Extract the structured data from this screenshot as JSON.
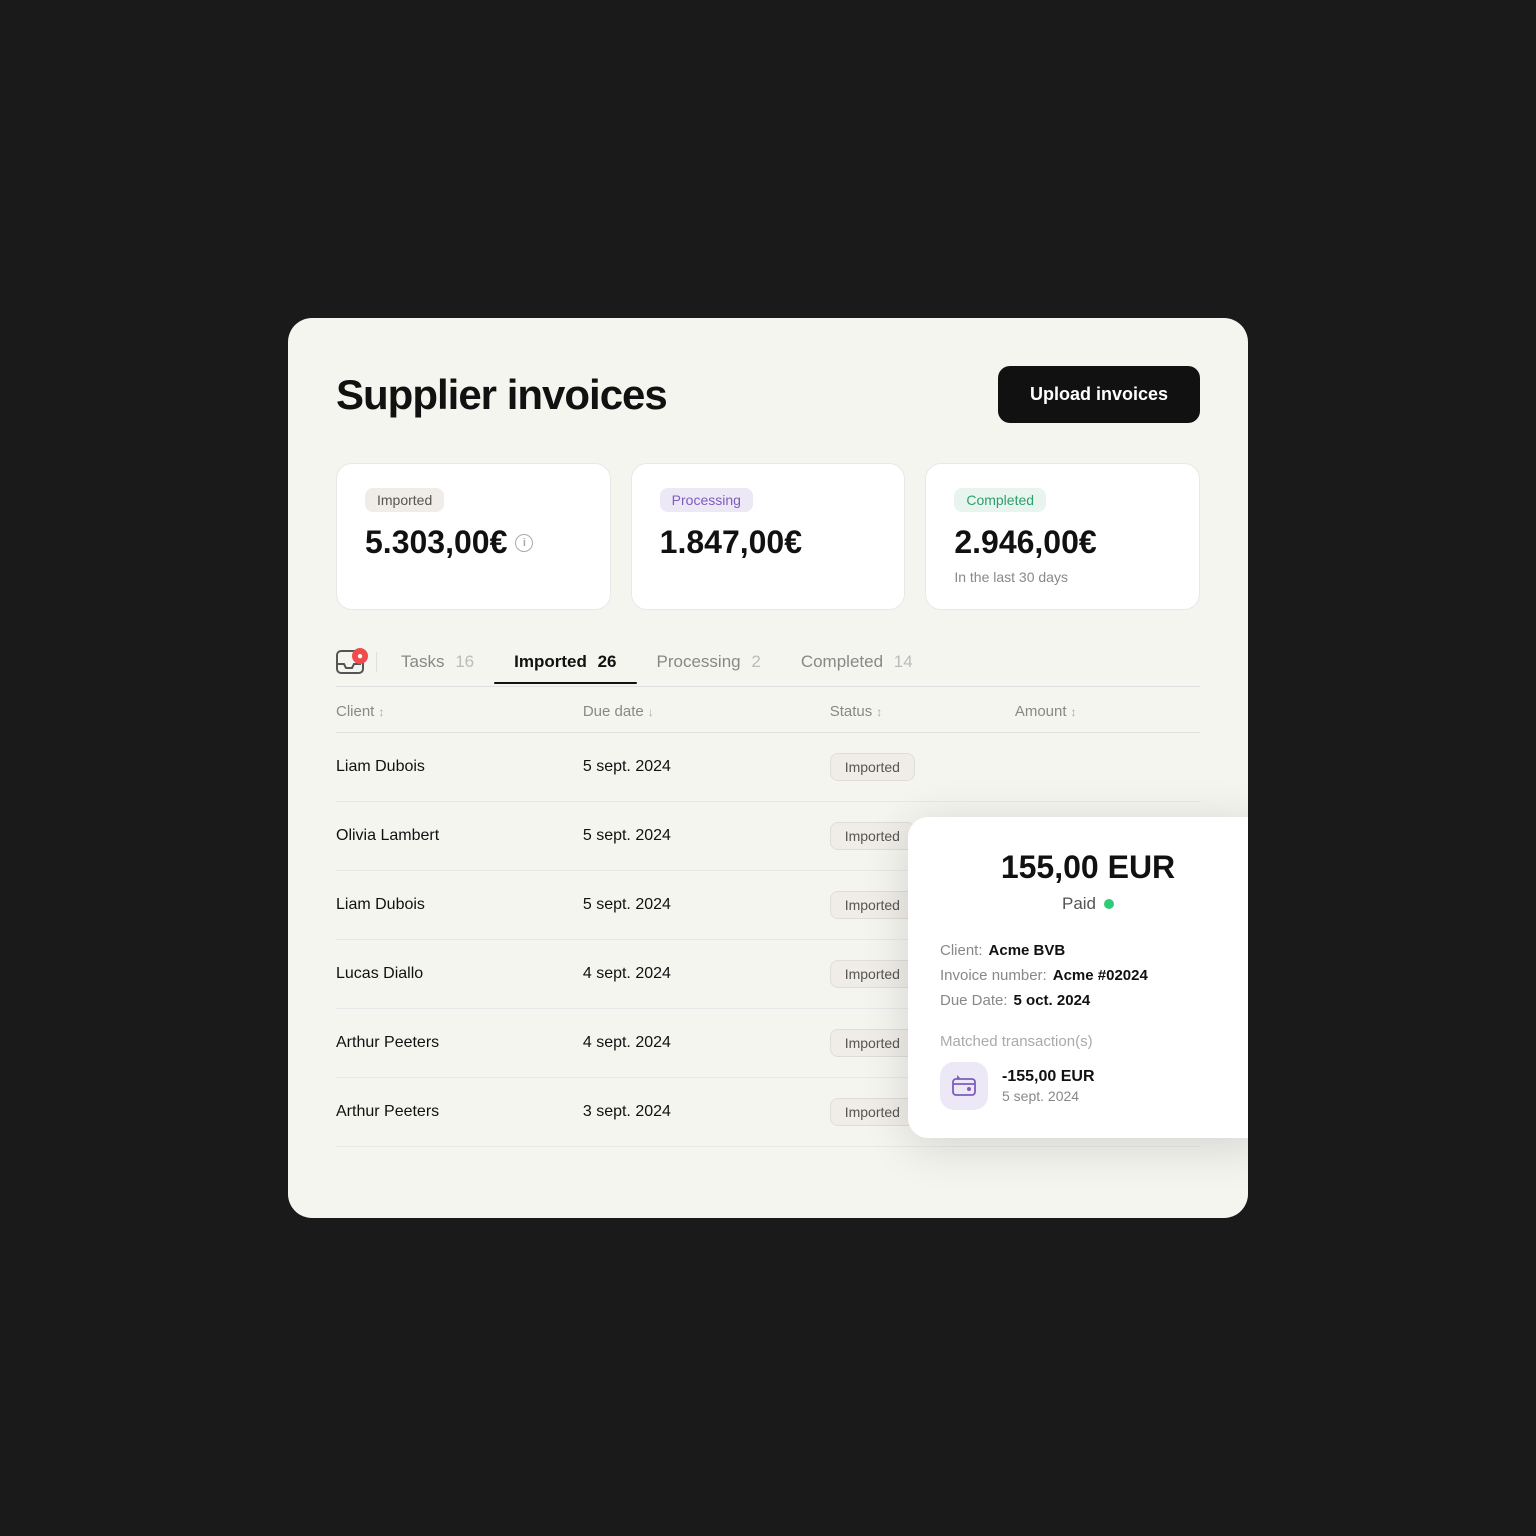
{
  "page": {
    "title": "Supplier invoices",
    "upload_button": "Upload invoices"
  },
  "stats": [
    {
      "badge": "Imported",
      "badge_type": "imported",
      "amount": "5.303,00€",
      "show_info": true,
      "subtitle": null
    },
    {
      "badge": "Processing",
      "badge_type": "processing",
      "amount": "1.847,00€",
      "show_info": false,
      "subtitle": null
    },
    {
      "badge": "Completed",
      "badge_type": "completed",
      "amount": "2.946,00€",
      "show_info": false,
      "subtitle": "In the last 30 days"
    }
  ],
  "tabs": [
    {
      "id": "tasks",
      "label": "Tasks",
      "count": "16",
      "active": false,
      "has_inbox": true
    },
    {
      "id": "imported",
      "label": "Imported",
      "count": "26",
      "active": true,
      "has_inbox": false
    },
    {
      "id": "processing",
      "label": "Processing",
      "count": "2",
      "active": false,
      "has_inbox": false
    },
    {
      "id": "completed",
      "label": "Completed",
      "count": "14",
      "active": false,
      "has_inbox": false
    }
  ],
  "table": {
    "headers": [
      {
        "label": "Client",
        "sort": "↕"
      },
      {
        "label": "Due date",
        "sort": "↓"
      },
      {
        "label": "Status",
        "sort": "↕"
      },
      {
        "label": "Amount",
        "sort": "↕"
      }
    ],
    "rows": [
      {
        "client": "Liam Dubois",
        "due_date": "5 sept. 2024",
        "status": "Imported",
        "amount": ""
      },
      {
        "client": "Olivia Lambert",
        "due_date": "5 sept. 2024",
        "status": "Imported",
        "amount": ""
      },
      {
        "client": "Liam Dubois",
        "due_date": "5 sept. 2024",
        "status": "Imported",
        "amount": ""
      },
      {
        "client": "Lucas Diallo",
        "due_date": "4 sept. 2024",
        "status": "Imported",
        "amount": ""
      },
      {
        "client": "Arthur Peeters",
        "due_date": "4 sept. 2024",
        "status": "Imported",
        "amount": ""
      },
      {
        "client": "Arthur Peeters",
        "due_date": "3 sept. 2024",
        "status": "Imported",
        "amount": ""
      }
    ]
  },
  "popup": {
    "amount": "155,00 EUR",
    "status": "Paid",
    "client_label": "Client:",
    "client_value": "Acme BVB",
    "invoice_label": "Invoice number:",
    "invoice_value": "Acme #02024",
    "due_date_label": "Due Date:",
    "due_date_value": "5 oct. 2024",
    "transactions_label": "Matched transaction(s)",
    "transaction_amount": "-155,00 EUR",
    "transaction_date": "5 sept. 2024"
  },
  "inbox_badge": "●"
}
